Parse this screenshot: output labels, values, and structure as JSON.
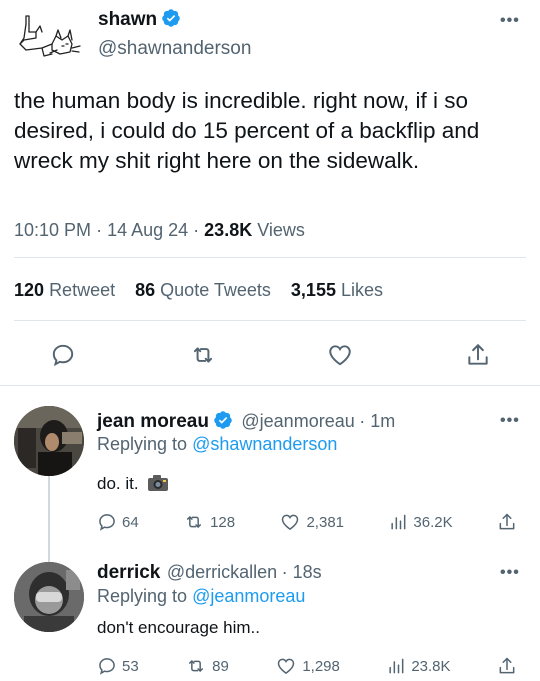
{
  "main_tweet": {
    "name": "shawn",
    "handle": "@shawnanderson",
    "text": "the human body is incredible. right now, if i so desired, i could do 15 percent of a backflip and wreck my shit right here on the sidewalk.",
    "time": "10:10 PM",
    "date": "14 Aug 24",
    "views_count": "23.8K",
    "views_label": "Views",
    "retweets_count": "120",
    "retweets_label": "Retweet",
    "quotes_count": "86",
    "quotes_label": "Quote Tweets",
    "likes_count": "3,155",
    "likes_label": "Likes",
    "more_icon": "more-dots-icon"
  },
  "replies": [
    {
      "name": "jean moreau",
      "handle": "@jeanmoreau",
      "time": "1m",
      "replying_prefix": "Replying to",
      "replying_to": "@shawnanderson",
      "text": "do. it.",
      "replies": "64",
      "retweets": "128",
      "likes": "2,381",
      "views": "36.2K"
    },
    {
      "name": "derrick",
      "handle": "@derrickallen",
      "time": "18s",
      "replying_prefix": "Replying to",
      "replying_to": "@jeanmoreau",
      "text": "don't encourage him..",
      "replies": "53",
      "retweets": "89",
      "likes": "1,298",
      "views": "23.8K"
    }
  ],
  "colors": {
    "accent": "#1d9bf0",
    "muted": "#536471",
    "text": "#0f1419",
    "divider": "#e1e6ea"
  }
}
